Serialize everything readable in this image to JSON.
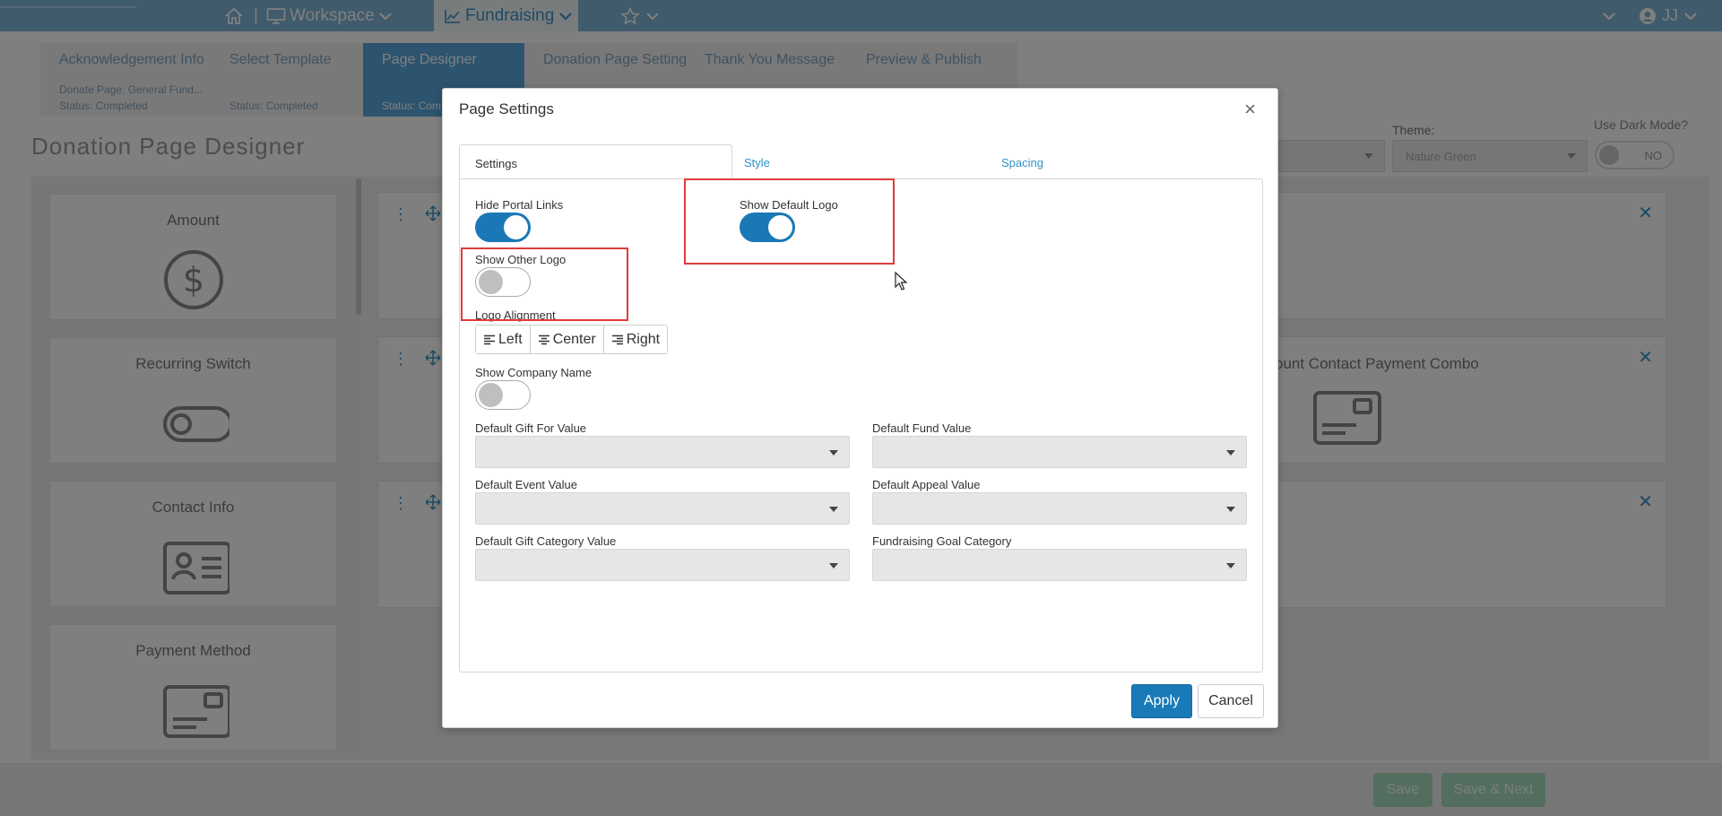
{
  "topbar": {
    "workspace_label": "Workspace",
    "fundraising_label": "Fundraising",
    "separator": "|",
    "user_initials": "JJ",
    "icons": [
      "home-icon",
      "monitor-icon",
      "chevron-down-icon",
      "line-chart-icon",
      "star-icon",
      "user-circle-icon"
    ]
  },
  "wizard": {
    "steps": [
      {
        "name": "Acknowledgement Info",
        "sub1": "Donate Page: General Fund...",
        "sub2": "Status: Completed"
      },
      {
        "name": "Select Template",
        "sub2": "Status: Completed"
      },
      {
        "name": "Page Designer",
        "sub2": "Status: Com"
      },
      {
        "name": "Donation Page Settings"
      },
      {
        "name": "Thank You Message"
      },
      {
        "name": "Preview & Publish"
      }
    ]
  },
  "page": {
    "title": "Donation Page Designer",
    "theme_label": "Theme:",
    "theme_value": "Nature Green",
    "dark_mode_label": "Use Dark Mode?",
    "dark_mode_value": "NO"
  },
  "palette": {
    "items": [
      {
        "title": "Amount",
        "icon": "dollar-circle-icon"
      },
      {
        "title": "Recurring Switch",
        "icon": "toggle-icon"
      },
      {
        "title": "Contact Info",
        "icon": "id-card-icon"
      },
      {
        "title": "Payment Method",
        "icon": "credit-card-icon"
      }
    ]
  },
  "canvas": {
    "card2_title": "ount Contact Payment Combo"
  },
  "footer": {
    "save_label": "Save",
    "save_next_label": "Save & Next"
  },
  "modal": {
    "title": "Page Settings",
    "close_glyph": "×",
    "tabs": {
      "settings": "Settings",
      "style": "Style",
      "spacing": "Spacing"
    },
    "hide_portal_links": {
      "label": "Hide Portal Links",
      "value": true
    },
    "show_default_logo": {
      "label": "Show Default Logo",
      "value": true
    },
    "show_other_logo": {
      "label": "Show Other Logo",
      "value": false
    },
    "logo_alignment": {
      "label": "Logo Alignment",
      "options": [
        "Left",
        "Center",
        "Right"
      ]
    },
    "show_company_name": {
      "label": "Show Company Name",
      "value": false
    },
    "fields": {
      "gift_for": "Default Gift For Value",
      "fund": "Default Fund Value",
      "event": "Default Event Value",
      "appeal": "Default Appeal Value",
      "gift_category": "Default Gift Category Value",
      "goal_category": "Fundraising Goal Category"
    },
    "apply_label": "Apply",
    "cancel_label": "Cancel"
  },
  "colors": {
    "topbar": "#7fb7d8",
    "primary": "#1a79b7",
    "highlight": "#e03b3b"
  }
}
